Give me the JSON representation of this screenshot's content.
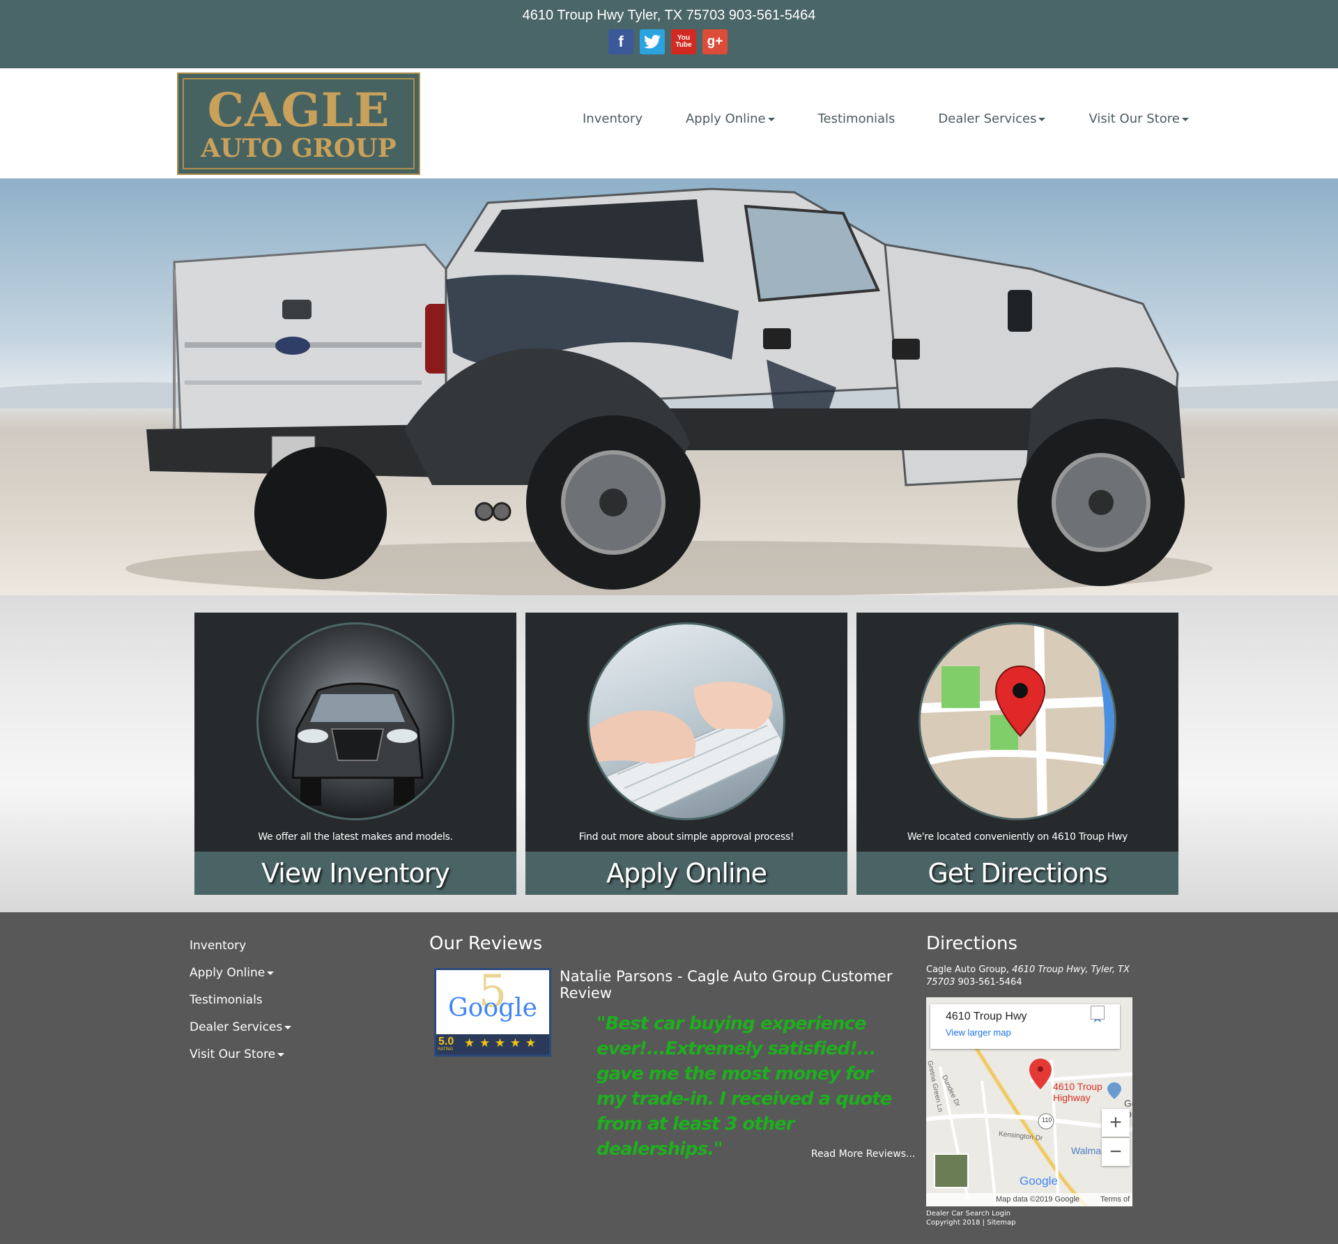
{
  "topbar": {
    "address": "4610 Troup Hwy Tyler, TX 75703 903-561-5464",
    "social": [
      {
        "icon": "facebook-icon",
        "glyph": "f",
        "color": "#3b5998"
      },
      {
        "icon": "twitter-icon",
        "glyph": "t",
        "color": "#2ba3e0"
      },
      {
        "icon": "youtube-icon",
        "glyph": "You Tube",
        "color": "#d22a22"
      },
      {
        "icon": "google-plus-icon",
        "glyph": "g+",
        "color": "#dd4b39"
      }
    ]
  },
  "logo": {
    "line1": "CAGLE",
    "line2": "AUTO GROUP"
  },
  "nav": {
    "inventory": "Inventory",
    "apply_online": "Apply Online",
    "testimonials": "Testimonials",
    "dealer_services": "Dealer Services",
    "visit_store": "Visit Our Store"
  },
  "cards": [
    {
      "blurb": "We offer all the latest makes and models.",
      "label": "View Inventory"
    },
    {
      "blurb": "Find out more about simple approval process!",
      "label": "Apply Online"
    },
    {
      "blurb": "We're located conveniently on 4610 Troup Hwy",
      "label": "Get Directions"
    }
  ],
  "footer": {
    "nav": {
      "inventory": "Inventory",
      "apply_online": "Apply Online",
      "testimonials": "Testimonials",
      "dealer_services": "Dealer Services",
      "visit_store": "Visit Our Store"
    },
    "reviews_title": "Our Reviews",
    "badge": {
      "brand": "Google",
      "rating": "5.0",
      "rating_word": "RATING",
      "stars": "★ ★ ★ ★ ★",
      "big_number": "5"
    },
    "review_head": "Natalie Parsons - Cagle Auto Group Customer Review",
    "quote": "\"Best car buying experience ever!...Extremely satisfied!... gave me the most money for my trade-in. I received a quote from at least 3 other dealerships.\"",
    "read_more": "Read More Reviews...",
    "directions_title": "Directions",
    "directions_name": "Cagle Auto Group, ",
    "directions_addr": "4610 Troup Hwy, Tyler, TX 75703",
    "directions_phone": " 903-561-5464",
    "map": {
      "place": "4610 Troup Hwy",
      "larger": "View larger map",
      "pin_label": "4610 Troup Highway",
      "get_dir": "Get Ou",
      "walmart": "Walmart",
      "route": "110",
      "street1": "Kensington Dr",
      "street2": "Dundee Dr",
      "street3": "Gretna Green Ln",
      "google": "Google",
      "map_data": "Map data ©2019 Google",
      "terms": "Terms of Use",
      "zoom_in": "+",
      "zoom_out": "−"
    },
    "login": "Dealer Car Search Login",
    "copyright": "Copyright 2018 | ",
    "sitemap": "Sitemap"
  }
}
